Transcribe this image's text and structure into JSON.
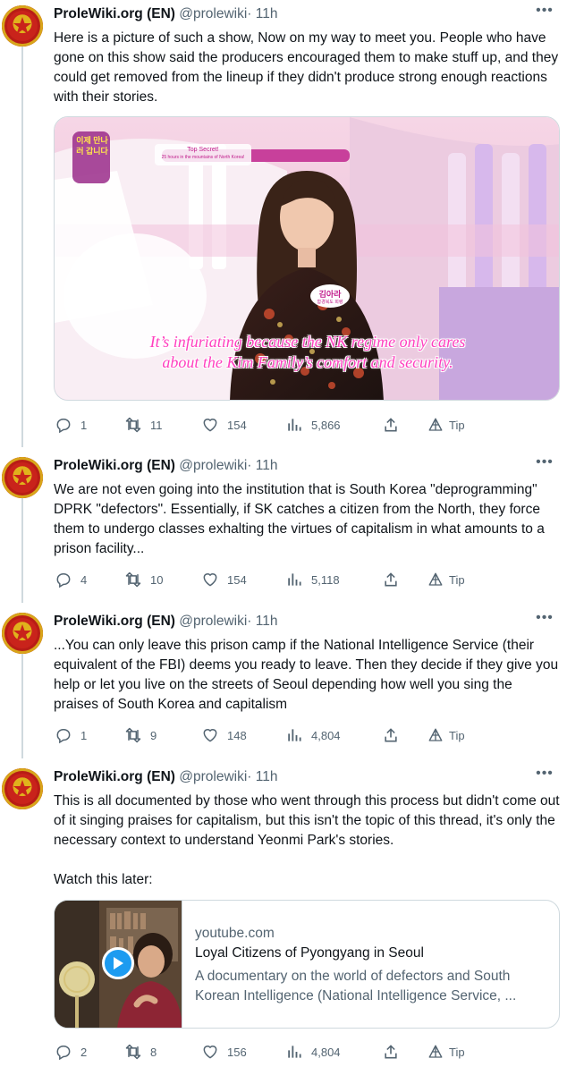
{
  "tweets": [
    {
      "name": "ProleWiki.org (EN)",
      "handle": "@prolewiki",
      "dot": "·",
      "time": "11h",
      "text": "Here is a picture of such a show, Now on my way to meet you. People who have gone on this show said the producers encouraged them to make stuff up, and they could get removed from the lineup if they didn't produce strong enough reactions with their stories.",
      "media": {
        "logo_text": "이제 만나러 갑니다",
        "banner_line1": "Top Secret!",
        "banner_line2": "25 hours in the mountains of North Korea!",
        "nametag": "김아라",
        "nametag_sub": "함경북도 회령",
        "subtitle_line1": "It’s infuriating because the NK regime only cares",
        "subtitle_line2": "about the Kim Family’s comfort and security."
      },
      "replies": "1",
      "retweets": "11",
      "likes": "154",
      "views": "5,866",
      "tip": "Tip"
    },
    {
      "name": "ProleWiki.org (EN)",
      "handle": "@prolewiki",
      "dot": "·",
      "time": "11h",
      "text": "We are not even going into the institution that is South Korea \"deprogramming\" DPRK \"defectors\". Essentially, if SK catches a citizen from the North, they force them to undergo classes exhalting the virtues of capitalism in what amounts to a prison facility...",
      "replies": "4",
      "retweets": "10",
      "likes": "154",
      "views": "5,118",
      "tip": "Tip"
    },
    {
      "name": "ProleWiki.org (EN)",
      "handle": "@prolewiki",
      "dot": "·",
      "time": "11h",
      "text": "...You can only leave this prison camp if the National Intelligence Service (their equivalent of the FBI) deems you ready to leave. Then they decide if they give you help or let you live on the streets of Seoul depending how well you sing the praises of South Korea and capitalism",
      "replies": "1",
      "retweets": "9",
      "likes": "148",
      "views": "4,804",
      "tip": "Tip"
    },
    {
      "name": "ProleWiki.org (EN)",
      "handle": "@prolewiki",
      "dot": "·",
      "time": "11h",
      "text": "This is all documented by those who went through this process but didn't come out of it singing praises for capitalism, but this isn't the topic of this thread, it's only the necessary context to understand Yeonmi Park's stories.\n\nWatch this later:",
      "card": {
        "domain": "youtube.com",
        "title": "Loyal Citizens of Pyongyang in Seoul",
        "description": "A documentary on the world of defectors and South Korean Intelligence (National Intelligence Service, ..."
      },
      "replies": "2",
      "retweets": "8",
      "likes": "156",
      "views": "4,804",
      "tip": "Tip"
    }
  ],
  "icons": {
    "more": "more-horizontal-icon",
    "reply": "reply-bubble-icon",
    "retweet": "retweet-arrows-icon",
    "like": "heart-outline-icon",
    "views": "bar-chart-icon",
    "share": "share-upload-icon",
    "tip": "tip-prism-icon",
    "play": "play-button-icon"
  },
  "colors": {
    "text": "#0f1419",
    "secondary": "#536471",
    "border": "#cfd9de",
    "avatar_red": "#c9231b",
    "avatar_gold": "#e0b21c",
    "play_blue": "#1d9bf0",
    "subtitle_pink": "#ff3fbf"
  }
}
